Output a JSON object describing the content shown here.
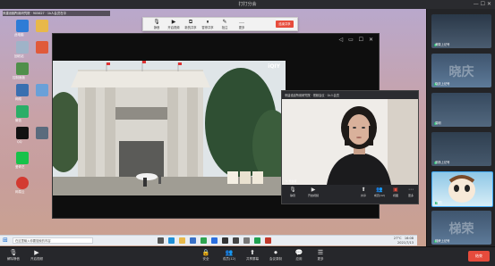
{
  "window": {
    "title": "打打分会",
    "controls": "— ☐ ✕"
  },
  "meeting_info": "来建设副所用研究院  ·  905627  ·  1k人会员在中",
  "share_toolbar": {
    "items": [
      {
        "glyph": "🎙",
        "label": "静音"
      },
      {
        "glyph": "▶",
        "label": "开启视频"
      },
      {
        "glyph": "⧉",
        "label": "新的共享"
      },
      {
        "glyph": "⏸",
        "label": "暂停共享"
      },
      {
        "glyph": "✎",
        "label": "批注"
      },
      {
        "glyph": "…",
        "label": "更多"
      }
    ],
    "stop_label": "结束共享"
  },
  "video_window": {
    "title_icons": "◁  ▭  ☐  ✕",
    "logo": "iQIY"
  },
  "mini_window": {
    "title": "来建设副所用研究院  ·  视频会议  ·  1k人会员",
    "name_tag": "✎ 代会者",
    "buttons": [
      {
        "glyph": "🎙",
        "label": "静音"
      },
      {
        "glyph": "▶",
        "label": "开启视频"
      },
      {
        "glyph": "⬆",
        "label": "共享"
      },
      {
        "glyph": "👥",
        "label": "成员(12)"
      },
      {
        "glyph": "▣",
        "label": "视图"
      },
      {
        "glyph": "⋯",
        "label": "更多"
      }
    ]
  },
  "taskbar": {
    "start_glyph": "⊞",
    "search_placeholder": "在这里输入你要搜索的内容",
    "tray_time": "16:08",
    "tray_date": "2021/7/13",
    "tray_weather": "27°C"
  },
  "desktop_icons": [
    "此电脑",
    "回收站",
    "控制面板",
    "网络",
    "微信",
    "QQ",
    "爱奇艺",
    "网易云"
  ],
  "sidebar": {
    "thumbs": [
      {
        "name": "黄徽上记号",
        "big": ""
      },
      {
        "name": "晓庆上记号",
        "big": "晓庆"
      },
      {
        "name": "易明",
        "big": ""
      },
      {
        "name": "张杨上记号",
        "big": ""
      },
      {
        "name": "张阳",
        "big": ""
      },
      {
        "name": "梯荣上记号",
        "big": "梯荣"
      }
    ]
  },
  "bottombar": {
    "buttons": [
      {
        "glyph": "🎙",
        "label": "解除静音"
      },
      {
        "glyph": "▶",
        "label": "开启视频"
      },
      {
        "glyph": "🔒",
        "label": "安全"
      },
      {
        "glyph": "👥",
        "label": "成员(12)"
      },
      {
        "glyph": "⬆",
        "label": "共享屏幕"
      },
      {
        "glyph": "⏺",
        "label": "会议录制"
      },
      {
        "glyph": "💬",
        "label": "应用"
      },
      {
        "glyph": "☰",
        "label": "更多"
      }
    ],
    "end_label": "结束"
  },
  "colors": {
    "accent_red": "#e64b3c",
    "dark_panel": "#26272b",
    "desktop_gradient_top": "#b9a8cc"
  }
}
